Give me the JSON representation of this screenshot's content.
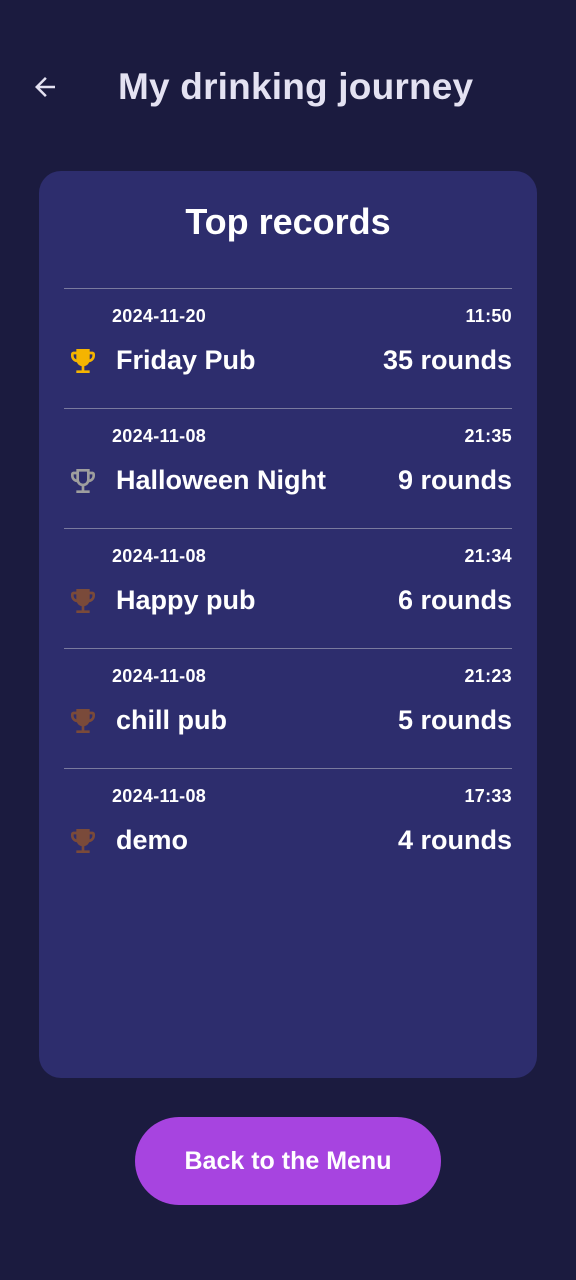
{
  "header": {
    "back_icon": "arrow-left-icon",
    "title": "My drinking journey"
  },
  "card": {
    "title": "Top records",
    "records": [
      {
        "date": "2024-11-20",
        "time": "11:50",
        "name": "Friday Pub",
        "rounds": "35 rounds",
        "trophy": "trophy-gold-icon",
        "trophy_color": "#f5b400"
      },
      {
        "date": "2024-11-08",
        "time": "21:35",
        "name": "Halloween Night",
        "rounds": "9 rounds",
        "trophy": "trophy-silver-icon",
        "trophy_color": "#9e9e9e"
      },
      {
        "date": "2024-11-08",
        "time": "21:34",
        "name": "Happy pub",
        "rounds": "6 rounds",
        "trophy": "trophy-bronze-icon",
        "trophy_color": "#7a4a3a"
      },
      {
        "date": "2024-11-08",
        "time": "21:23",
        "name": "chill pub",
        "rounds": "5 rounds",
        "trophy": "trophy-bronze-icon",
        "trophy_color": "#7a4a3a"
      },
      {
        "date": "2024-11-08",
        "time": "17:33",
        "name": "demo",
        "rounds": "4 rounds",
        "trophy": "trophy-bronze-icon",
        "trophy_color": "#7a4a3a"
      }
    ]
  },
  "footer": {
    "menu_button_label": "Back to the Menu"
  },
  "colors": {
    "background": "#1b1b3f",
    "card": "#2d2d6d",
    "accent_button": "#a744e0",
    "divider": "#7a7a9e"
  }
}
